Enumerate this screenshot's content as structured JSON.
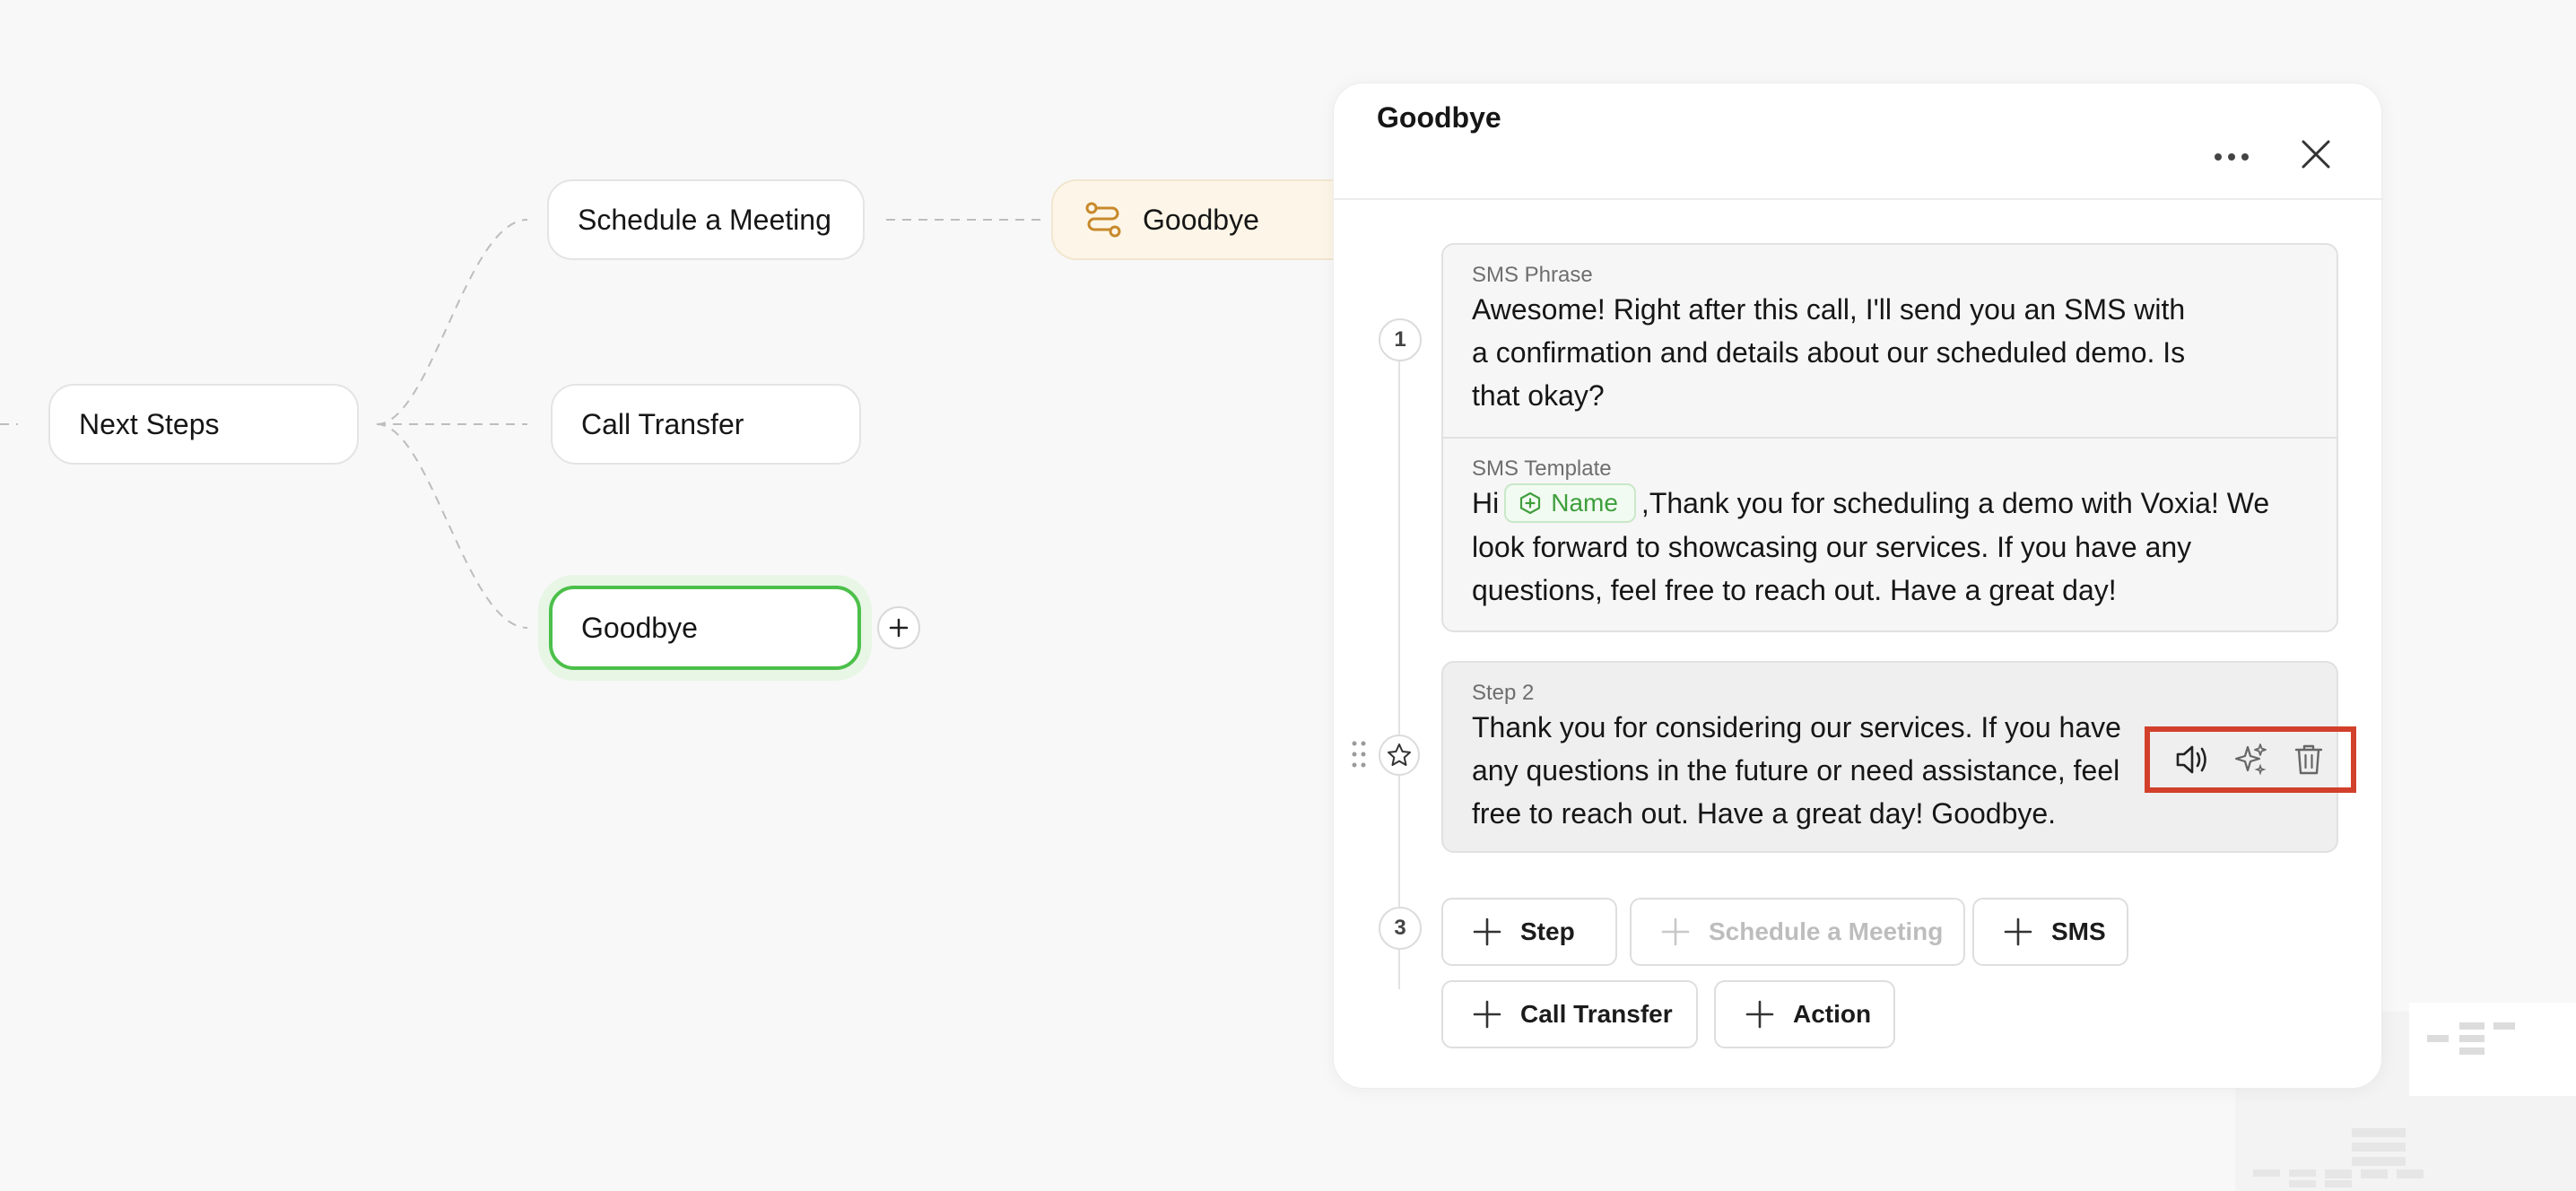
{
  "flow": {
    "nodes": {
      "schedule_meeting": "Schedule a Meeting",
      "goodbye_goto": "Goodbye",
      "next_steps": "Next Steps",
      "call_transfer": "Call Transfer",
      "goodbye": "Goodbye"
    }
  },
  "panel": {
    "title": "Goodbye",
    "steps": [
      {
        "number": "1",
        "sms_phrase_label": "SMS Phrase",
        "sms_phrase_text": "Awesome! Right after this call, I'll send you an SMS with a confirmation and details about our scheduled demo. Is that okay?",
        "sms_template_label": "SMS Template",
        "sms_template_prefix": "Hi",
        "sms_template_variable": "Name",
        "sms_template_text": ",Thank you for scheduling a demo with Voxia! We look forward to showcasing our services. If you have any questions, feel free to reach out. Have a great day!"
      },
      {
        "label": "Step 2",
        "text": "Thank you for considering our services. If you have any questions in the future or need assistance, feel free to reach out. Have a great day! Goodbye."
      }
    ],
    "next_number": "3",
    "add_buttons": {
      "step": "Step",
      "schedule_meeting": "Schedule a Meeting",
      "sms": "SMS",
      "call_transfer": "Call Transfer",
      "action": "Action"
    }
  },
  "colors": {
    "accent_green": "#4cc04a",
    "highlight_red": "#d2402b",
    "goto_node_bg": "#fdf6e8",
    "goto_icon": "#c8892b"
  }
}
